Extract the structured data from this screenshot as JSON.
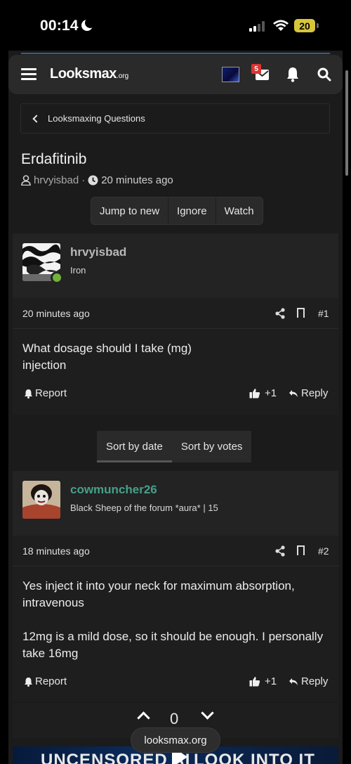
{
  "status_bar": {
    "time": "00:14",
    "battery": "20"
  },
  "nav": {
    "logo_main": "Looksmax",
    "logo_suffix": ".org",
    "mail_count": "5"
  },
  "breadcrumb": {
    "label": "Looksmaxing Questions"
  },
  "thread": {
    "title": "Erdafitinib",
    "author": "hrvyisbad",
    "separator": "·",
    "time": "20 minutes ago",
    "buttons": [
      "Jump to new",
      "Ignore",
      "Watch"
    ]
  },
  "sort_tabs": [
    "Sort by date",
    "Sort by votes"
  ],
  "posts": [
    {
      "username": "hrvyisbad",
      "user_title": "Iron",
      "username_color": "#b8b8b8",
      "time": "20 minutes ago",
      "number": "#1",
      "body_lines": [
        "What dosage should I take (mg)",
        "injection"
      ],
      "report": "Report",
      "like": "+1",
      "reply": "Reply"
    },
    {
      "username": "cowmuncher26",
      "user_title": "Black Sheep of the forum *aura* | 15",
      "username_color": "#46a08a",
      "time": "18 minutes ago",
      "number": "#2",
      "body_lines": [
        "Yes inject it into your neck for maximum absorption, intravenous",
        "12mg is a mild dose, so it should be enough. I personally take 16mg"
      ],
      "report": "Report",
      "like": "+1",
      "reply": "Reply"
    }
  ],
  "vote": {
    "count": "0"
  },
  "banner": {
    "left": "UNCENSORED AI",
    "right": "LOOK INTO IT"
  },
  "url": "looksmax.org",
  "colors": {
    "online": "#6fb33a",
    "accent_line": "#3a5e84",
    "badge": "#dd3333"
  }
}
